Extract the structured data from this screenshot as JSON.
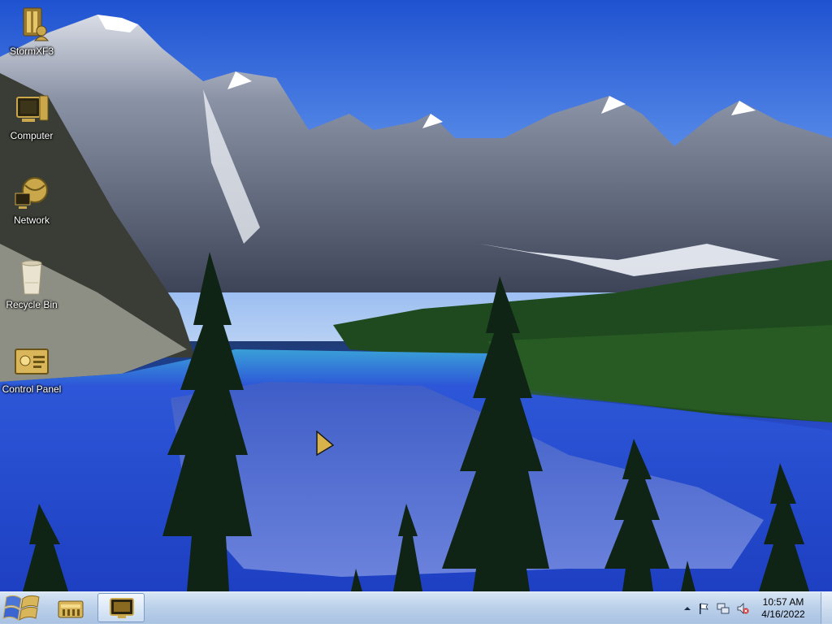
{
  "desktop": {
    "icons": [
      {
        "label": "StormXF3",
        "icon": "application-icon"
      },
      {
        "label": "Computer",
        "icon": "computer-icon"
      },
      {
        "label": "Network",
        "icon": "network-icon"
      },
      {
        "label": "Recycle Bin",
        "icon": "recycle-bin-icon"
      },
      {
        "label": "Control Panel",
        "icon": "control-panel-icon"
      }
    ]
  },
  "taskbar": {
    "start_icon": "windows-logo-icon",
    "pinned": [
      {
        "icon": "folder-icon",
        "active": false
      },
      {
        "icon": "display-icon",
        "active": true
      }
    ],
    "tray": {
      "icons": [
        "chevron-up-icon",
        "flag-icon",
        "network-icon",
        "volume-muted-icon"
      ],
      "time": "10:57 AM",
      "date": "4/16/2022"
    }
  },
  "colors": {
    "taskbar": "#bcd1ea",
    "sky": "#2a5bd6",
    "lake": "#2849c7",
    "forest": "#1f4a1f",
    "icon_gold": "#c9a74a"
  }
}
